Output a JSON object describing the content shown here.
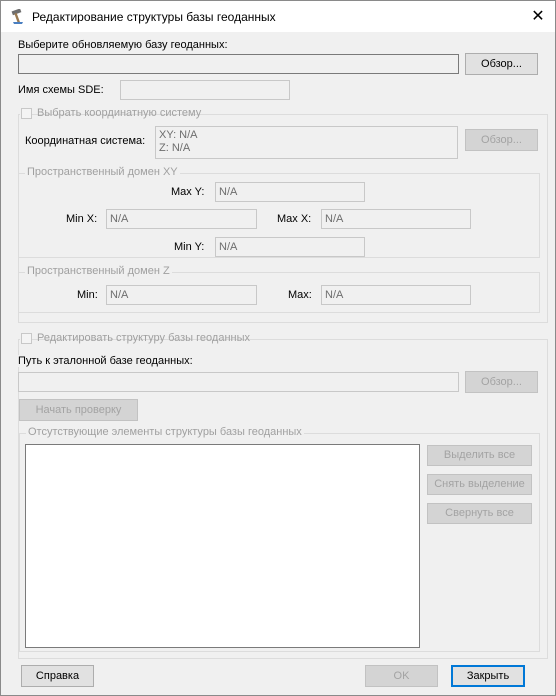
{
  "window": {
    "title": "Редактирование структуры базы геоданных",
    "close_glyph": "✕",
    "icon": "hammer-app-icon"
  },
  "db_section": {
    "select_label": "Выберите обновляемую базу геоданных:",
    "path_value": "",
    "browse_label": "Обзор...",
    "sde_schema_label": "Имя схемы SDE:",
    "sde_schema_value": ""
  },
  "coord_section": {
    "checkbox_label": "Выбрать координатную систему",
    "checked": false,
    "coord_label": "Координатная система:",
    "coord_xy": "XY: N/A",
    "coord_z": "Z: N/A",
    "browse_label": "Обзор...",
    "xy_domain": {
      "title": "Пространственный домен XY",
      "max_y_label": "Max Y:",
      "max_y_value": "N/A",
      "min_x_label": "Min X:",
      "min_x_value": "N/A",
      "max_x_label": "Max X:",
      "max_x_value": "N/A",
      "min_y_label": "Min Y:",
      "min_y_value": "N/A"
    },
    "z_domain": {
      "title": "Пространственный домен Z",
      "min_label": "Min:",
      "min_value": "N/A",
      "max_label": "Max:",
      "max_value": "N/A"
    }
  },
  "edit_section": {
    "checkbox_label": "Редактировать структуру базы геоданных",
    "checked": false,
    "ref_path_label": "Путь к эталонной базе геоданных:",
    "ref_path_value": "",
    "browse_label": "Обзор...",
    "check_button_label": "Начать проверку",
    "missing_group_title": "Отсутствующие элементы структуры базы геоданных",
    "missing_items": [],
    "select_all_label": "Выделить все",
    "deselect_label": "Снять выделение",
    "collapse_label": "Свернуть все"
  },
  "footer": {
    "help_label": "Справка",
    "ok_label": "OK",
    "close_label": "Закрыть"
  },
  "colors": {
    "accent": "#0078d7",
    "dialog_bg": "#f0f0f0",
    "disabled_text": "#a0a0a0"
  }
}
